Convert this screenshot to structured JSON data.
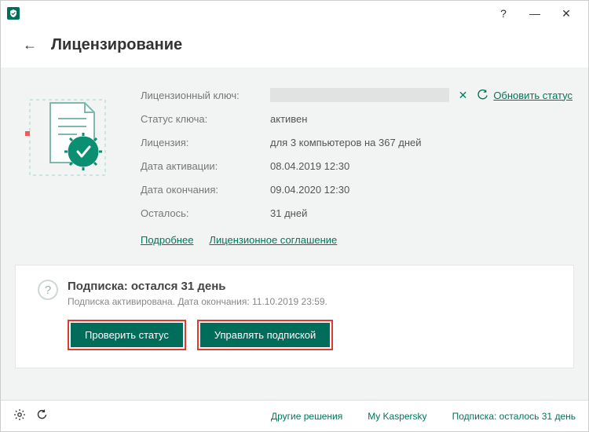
{
  "titlebar": {
    "help_icon": "?",
    "minimize_icon": "—",
    "close_icon": "✕"
  },
  "header": {
    "back_icon": "←",
    "title": "Лицензирование"
  },
  "license": {
    "labels": {
      "key": "Лицензионный ключ:",
      "status": "Статус ключа:",
      "license": "Лицензия:",
      "activation_date": "Дата активации:",
      "expiry_date": "Дата окончания:",
      "remaining": "Осталось:"
    },
    "values": {
      "status": "активен",
      "license": "для 3 компьютеров на 367 дней",
      "activation_date": "08.04.2019 12:30",
      "expiry_date": "09.04.2020 12:30",
      "remaining": "31 дней"
    },
    "close_key_icon": "✕",
    "update_status_label": "Обновить статус",
    "links": {
      "details": "Подробнее",
      "agreement": "Лицензионное соглашение"
    }
  },
  "subscription": {
    "q_icon": "?",
    "title": "Подписка: остался 31 день",
    "desc": "Подписка активирована. Дата окончания: 11.10.2019 23:59.",
    "buttons": {
      "check": "Проверить статус",
      "manage": "Управлять подпиской"
    }
  },
  "footer": {
    "other_solutions": "Другие решения",
    "my_kaspersky": "My Kaspersky",
    "sub_status": "Подписка: осталось 31 день"
  }
}
